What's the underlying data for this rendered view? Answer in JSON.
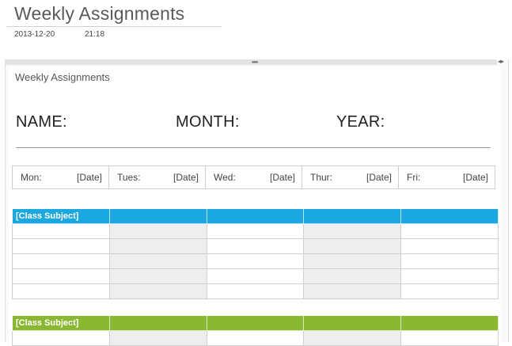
{
  "page": {
    "title": "Weekly Assignments",
    "date": "2013-12-20",
    "time": "21:18"
  },
  "sheet": {
    "title": "Weekly Assignments",
    "name_label": "NAME:",
    "month_label": "MONTH:",
    "year_label": "YEAR:"
  },
  "days": [
    {
      "day": "Mon:",
      "date": "[Date]"
    },
    {
      "day": "Tues:",
      "date": "[Date]"
    },
    {
      "day": "Wed:",
      "date": "[Date]"
    },
    {
      "day": "Thur:",
      "date": "[Date]"
    },
    {
      "day": "Fri:",
      "date": "[Date]"
    }
  ],
  "subjects": [
    {
      "label": "[Class Subject]",
      "color": "#1ba8e0"
    },
    {
      "label": "[Class Subject]",
      "color": "#8ab833"
    }
  ],
  "colors": {
    "accent_blue": "#1ba8e0",
    "accent_green": "#8ab833",
    "shaded_column": "#eeeeee"
  }
}
